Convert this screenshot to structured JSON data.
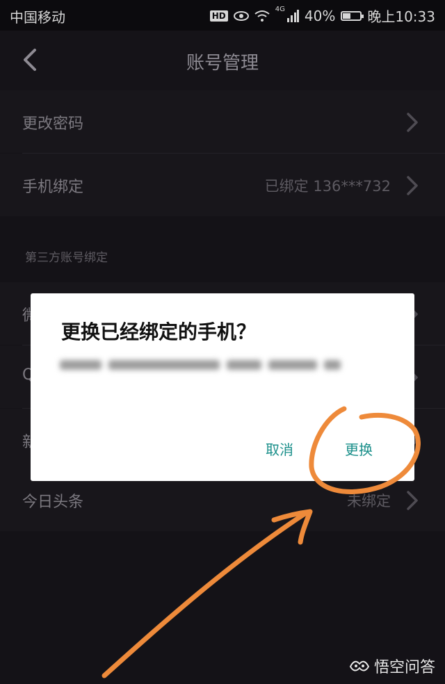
{
  "status_bar": {
    "carrier": "中国移动",
    "hd": "HD",
    "network": "4G",
    "battery": "40%",
    "battery_level": 0.4,
    "time": "晚上10:33"
  },
  "header": {
    "title": "账号管理"
  },
  "settings": {
    "change_password": "更改密码",
    "phone_binding": "手机绑定",
    "phone_binding_value": "已绑定 136***732",
    "third_party_section": "第三方账号绑定",
    "wechat_partial": "微",
    "qq_partial": "Q",
    "weibo_partial": "新",
    "toutiao": "今日头条",
    "toutiao_value": "未绑定"
  },
  "dialog": {
    "title": "更换已经绑定的手机？",
    "cancel": "取消",
    "confirm": "更换"
  },
  "watermark": {
    "text": "悟空问答"
  },
  "colors": {
    "accent": "#1a8f8a",
    "annotation": "#ee8a3a"
  }
}
